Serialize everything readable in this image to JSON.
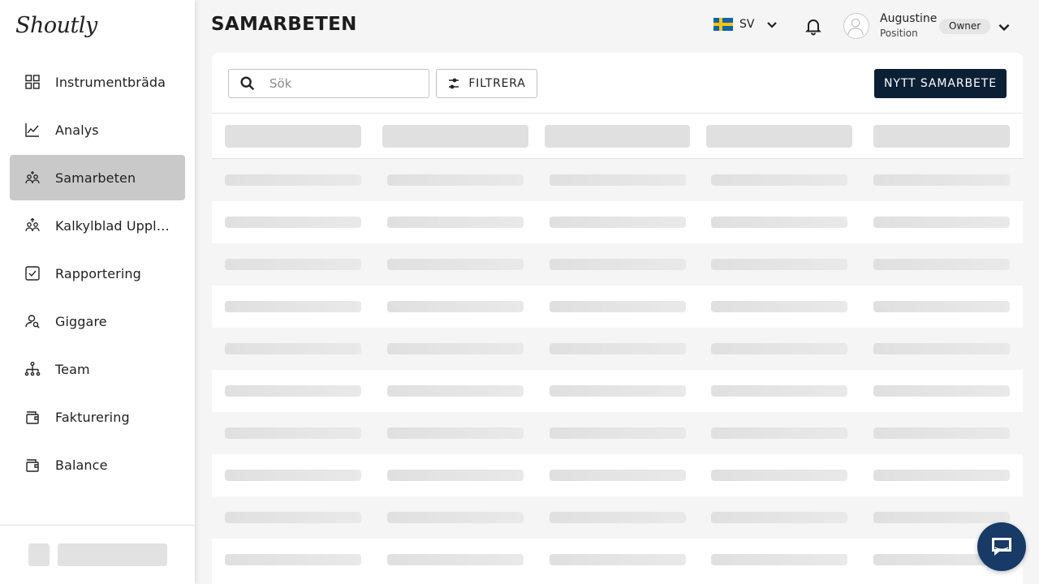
{
  "app": {
    "logo_text": "Shoutly"
  },
  "sidebar": {
    "items": [
      {
        "label": "Instrumentbräda",
        "icon": "grid-icon",
        "active": false
      },
      {
        "label": "Analys",
        "icon": "line-chart-icon",
        "active": false
      },
      {
        "label": "Samarbeten",
        "icon": "collaborations-icon",
        "active": true
      },
      {
        "label": "Kalkylblad Uppladdning",
        "icon": "spreadsheet-upload-icon",
        "active": false
      },
      {
        "label": "Rapportering",
        "icon": "checkbox-icon",
        "active": false
      },
      {
        "label": "Giggare",
        "icon": "user-search-icon",
        "active": false
      },
      {
        "label": "Team",
        "icon": "team-tree-icon",
        "active": false
      },
      {
        "label": "Fakturering",
        "icon": "wallet-icon",
        "active": false
      },
      {
        "label": "Balance",
        "icon": "wallet-icon",
        "active": false
      }
    ]
  },
  "header": {
    "title": "SAMARBETEN",
    "language": {
      "code": "SV",
      "flag": "sweden-flag-icon"
    },
    "user": {
      "name": "Augustine",
      "position": "Position",
      "role": "Owner"
    }
  },
  "toolbar": {
    "search_placeholder": "Sök",
    "search_value": "",
    "filter_label": "FILTRERA",
    "new_label": "NYTT SAMARBETE"
  },
  "table": {
    "loading": true,
    "column_count": 5,
    "skeleton_rows": 10
  },
  "colors": {
    "primary": "#0b1f35",
    "chat": "#173a66",
    "active_nav": "#c9c9c9"
  }
}
